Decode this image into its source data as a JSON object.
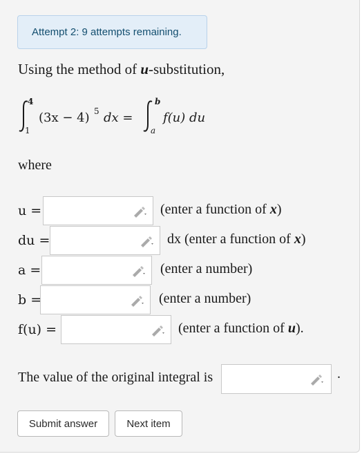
{
  "attempt_banner": "Attempt 2: 9 attempts remaining.",
  "intro": {
    "prefix": "Using the method of ",
    "var": "u",
    "suffix": "-substitution,"
  },
  "equation": {
    "lower": "1",
    "upper": "4",
    "integrand": "(3x − 4)",
    "power": "5",
    "dx": "dx =",
    "rhs_lower": "a",
    "rhs_upper": "b",
    "rhs_integrand": "f(u) du"
  },
  "where_label": "where",
  "fields": [
    {
      "label": "u =",
      "hint": "(enter a function of ",
      "hint_var": "x",
      "hint_end": ")"
    },
    {
      "label": "du =",
      "hint": "dx (enter a function of ",
      "hint_var": "x",
      "hint_end": ")"
    },
    {
      "label": "a =",
      "hint": "(enter a number)",
      "hint_var": "",
      "hint_end": ""
    },
    {
      "label": "b =",
      "hint": "(enter a number)",
      "hint_var": "",
      "hint_end": ""
    },
    {
      "label": "f(u) =",
      "hint": "(enter a function of ",
      "hint_var": "u",
      "hint_end": ")."
    }
  ],
  "final_text": "The value of the original integral is",
  "final_period": ".",
  "buttons": {
    "submit": "Submit answer",
    "next": "Next item"
  },
  "icons": {
    "input_edit": "pencil-icon"
  }
}
